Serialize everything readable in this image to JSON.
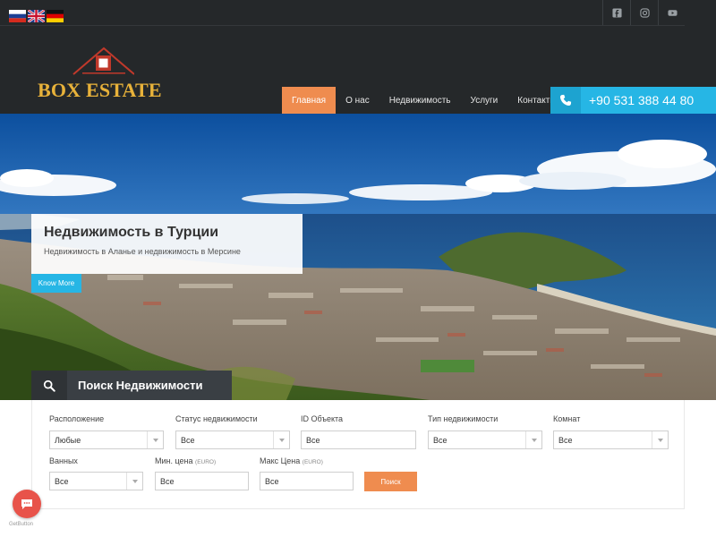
{
  "header": {
    "languages": [
      {
        "name": "russian-flag-icon",
        "lang": "ru"
      },
      {
        "name": "english-flag-icon",
        "lang": "en"
      },
      {
        "name": "german-flag-icon",
        "lang": "de"
      }
    ],
    "social_icons": [
      "facebook-icon",
      "instagram-icon",
      "youtube-icon"
    ],
    "logo_text": "BOX ESTATE",
    "nav": [
      {
        "label": "Главная",
        "active": true
      },
      {
        "label": "О нас"
      },
      {
        "label": "Недвижимость"
      },
      {
        "label": "Услуги"
      },
      {
        "label": "Контакты"
      }
    ],
    "phone": "+90 531 388 44 80",
    "colors": {
      "accent": "#ef8c4f",
      "phone_bg": "#26b6e5",
      "header_bg": "#25282a",
      "logo": "#e8b23a"
    }
  },
  "hero": {
    "title": "Недвижимость в Турции",
    "subtitle": "Недвижимость в Аланье и недвижимость в Мерсине",
    "button": "Know More"
  },
  "search": {
    "tab_label": "Поиск Недвижимости",
    "fields": {
      "location": {
        "label": "Расположение",
        "value": "Любые"
      },
      "status": {
        "label": "Статус недвижимости",
        "value": "Все"
      },
      "object_id": {
        "label": "ID Объекта",
        "value": "Все"
      },
      "type": {
        "label": "Тип недвижимости",
        "value": "Все"
      },
      "rooms": {
        "label": "Комнат",
        "value": "Все"
      },
      "bathrooms": {
        "label": "Ванных",
        "value": "Все"
      },
      "min_price": {
        "label": "Мин. цена",
        "unit": "(EURO)",
        "value": "Все"
      },
      "max_price": {
        "label": "Макс Цена",
        "unit": "(EURO)",
        "value": "Все"
      }
    },
    "button": "Поиск"
  },
  "widget": {
    "label": "GetButton"
  }
}
